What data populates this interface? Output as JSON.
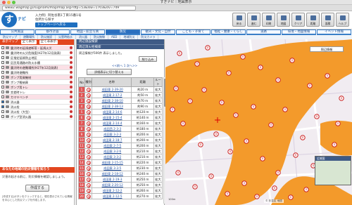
{
  "window": {
    "title": "すぎナビ｜地図表示",
    "url": "www2.wagmap.jp/suginami/map/map.asp?dtp=53&lsw=1703&slv=749"
  },
  "header": {
    "logo_text": "す",
    "logo_sub": "ナビ",
    "address_line1": "入力例）阿佐谷南1丁目15番1号",
    "address_line2": "住所から探す",
    "home_button": "トップページへ戻る",
    "tools": [
      "戻る",
      "進む",
      "印刷",
      "地図",
      "クリア",
      "距離",
      "面積",
      "ヘルプ"
    ]
  },
  "nav": {
    "tabs": [
      "公共施設",
      "都市計画",
      "地図・航空写真",
      "防災",
      "観光・文化・自然",
      "こども・子育て",
      "福祉・健康・くらし",
      "道路",
      "環境・地図情報",
      "イベント情報"
    ],
    "active_index": 3
  },
  "subnav": [
    "防災マップ",
    "避難場所",
    "防災施設",
    "災害時給水",
    "消火器",
    "防災無線",
    "AED",
    "地域防災",
    "防災カメラ"
  ],
  "left": {
    "bar_label": "表示マップ",
    "mini_buttons": [
      "全て表示",
      "全て非表示"
    ],
    "layers": [
      {
        "label": "震災時の延焼遮断帯・延焼火災",
        "checked": false,
        "pink": true
      },
      {
        "label": "震災時の火災危険度(H27年12月発表)",
        "checked": false,
        "pink": false
      },
      {
        "label": "区指定延焼防止地区",
        "checked": false,
        "pink": false
      },
      {
        "label": "区民用通路の防火水槽",
        "checked": false,
        "pink": false
      },
      {
        "label": "震災時の避難場所(H27年12月発表)",
        "checked": false,
        "pink": true
      },
      {
        "label": "震災時避難所",
        "checked": false,
        "pink": false
      },
      {
        "label": "ポンプ用資機材",
        "checked": false,
        "pink": true
      },
      {
        "label": "ポンプ格納庫",
        "checked": false,
        "pink": false
      },
      {
        "label": "ポンプ用トレ",
        "checked": false,
        "pink": true
      },
      {
        "label": "交差時トレ",
        "checked": false,
        "pink": false
      },
      {
        "label": "カマヤベンチ",
        "checked": false,
        "pink": true
      },
      {
        "label": "消火器",
        "checked": true,
        "pink": false
      },
      {
        "label": "消火栓",
        "checked": true,
        "pink": false
      },
      {
        "label": "消火栓（大型）",
        "checked": false,
        "pink": false
      },
      {
        "label": "ポンプ型消火器",
        "checked": false,
        "pink": false
      }
    ],
    "info_title": "あなたの地域の防災情報を知ろう",
    "info_text": "災害の起きる前に、防災情報を確認しましょう。",
    "create_button": "作成する",
    "footnote": "[作成する]ボタンをクリックすると、現在表示されている情報を中心とした防災マップを作成します。"
  },
  "center": {
    "head": "周辺施設検索",
    "head2": "周辺消火栓検索",
    "message": "周辺情報が506件 表示しました。",
    "narrow_button": "絞り込み",
    "pager": "<<前へ 1 次へ>>",
    "detail_button": "詳細表示に切り替える",
    "columns": [
      "No",
      "種別",
      "名称",
      "距離",
      "ルート"
    ],
    "rows": [
      {
        "no": "1",
        "name": "成田東 2-39-20",
        "dist": "約20 m",
        "route": "拡大"
      },
      {
        "no": "2",
        "name": "成田東 2-17-2",
        "dist": "約50 m",
        "route": "拡大"
      },
      {
        "no": "3",
        "name": "成田東 2-38-10",
        "dist": "約70 m",
        "route": "拡大"
      },
      {
        "no": "4",
        "name": "成田東 2-38-13",
        "dist": "約90 m",
        "route": "拡大"
      },
      {
        "no": "5",
        "name": "成田東 2-14-6",
        "dist": "約120 m",
        "route": "拡大"
      },
      {
        "no": "6",
        "name": "成田東 2-15-4",
        "dist": "約140 m",
        "route": "拡大"
      },
      {
        "no": "7",
        "name": "成田東 2-14-4",
        "dist": "約160 m",
        "route": "拡大"
      },
      {
        "no": "8",
        "name": "成田西 2-3-3",
        "dist": "約180 m",
        "route": "拡大"
      },
      {
        "no": "9",
        "name": "成田東 3-2-3",
        "dist": "約200 m",
        "route": "拡大"
      },
      {
        "no": "10",
        "name": "成田東 2-18-7",
        "dist": "約200 m",
        "route": "拡大"
      },
      {
        "no": "11",
        "name": "成田東 2-7-5",
        "dist": "約200 m",
        "route": "拡大"
      },
      {
        "no": "12",
        "name": "成田東 3-2-6",
        "dist": "約210 m",
        "route": "拡大"
      },
      {
        "no": "13",
        "name": "成田東 3-3-2",
        "dist": "約210 m",
        "route": "拡大"
      },
      {
        "no": "14",
        "name": "成田東 2-15-15",
        "dist": "約220 m",
        "route": "拡大"
      },
      {
        "no": "15",
        "name": "成田東 3-3-5",
        "dist": "約230 m",
        "route": "拡大"
      },
      {
        "no": "16",
        "name": "成田東 2-18-12",
        "dist": "約240 m",
        "route": "拡大"
      },
      {
        "no": "17",
        "name": "成田東 2-19-3",
        "dist": "約250 m",
        "route": "拡大"
      },
      {
        "no": "18",
        "name": "成田東 2-20-12",
        "dist": "約250 m",
        "route": "拡大"
      },
      {
        "no": "19",
        "name": "成田東 2-12-2",
        "dist": "約260 m",
        "route": "拡大"
      },
      {
        "no": "20",
        "name": "成田東 2-12-5",
        "dist": "約270 m",
        "route": "拡大"
      }
    ]
  },
  "map": {
    "legend_button": "周辺情報",
    "minimap_label": "広域図",
    "copyright": "© 杉並区 地図",
    "scale": "100m",
    "colors": {
      "fire_zone": "#f39a2b",
      "background": "#f1ecf1",
      "hydrant": "#c22"
    }
  }
}
